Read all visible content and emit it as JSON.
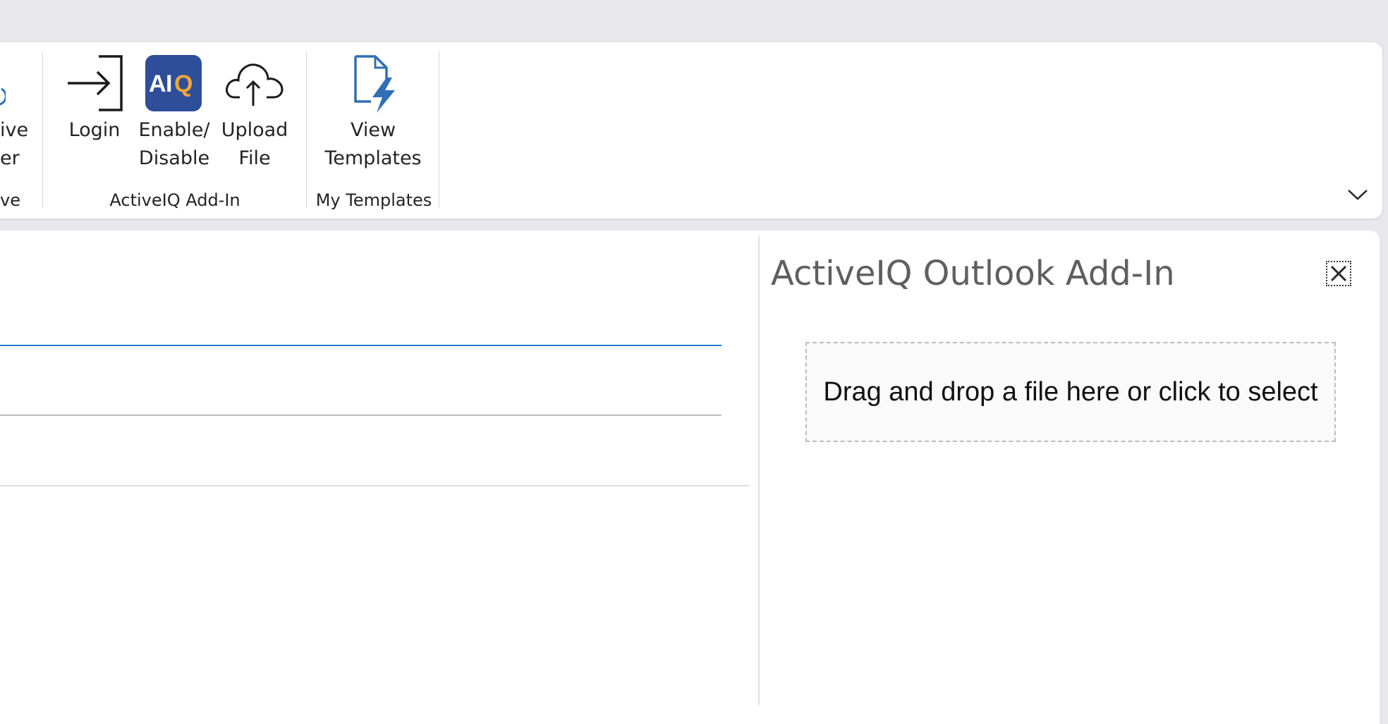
{
  "ribbon": {
    "partial_left": {
      "label_line1": "ive",
      "label_line2": "er",
      "group_label": "ve"
    },
    "groups": [
      {
        "label": "ActiveIQ Add-In",
        "buttons": [
          {
            "label": "Login",
            "icon": "sign-in-arrow-icon"
          },
          {
            "label_line1": "Enable/",
            "label_line2": "Disable",
            "icon": "activeiq-logo-icon",
            "logo_text": "AIQ"
          },
          {
            "label_line1": "Upload",
            "label_line2": "File",
            "icon": "cloud-upload-icon"
          }
        ]
      },
      {
        "label": "My Templates",
        "buttons": [
          {
            "label_line1": "View",
            "label_line2": "Templates",
            "icon": "document-flash-icon"
          }
        ]
      }
    ],
    "collapse_icon": "chevron-down-icon"
  },
  "task_pane": {
    "title": "ActiveIQ Outlook Add-In",
    "close_icon": "close-icon",
    "dropzone_text": "Drag and drop a file here or click to select"
  },
  "colors": {
    "accent": "#2b579a",
    "logo_bg": "#2e4e9a",
    "logo_q": "#f0a63a",
    "icon_blue": "#2f6fb6"
  }
}
